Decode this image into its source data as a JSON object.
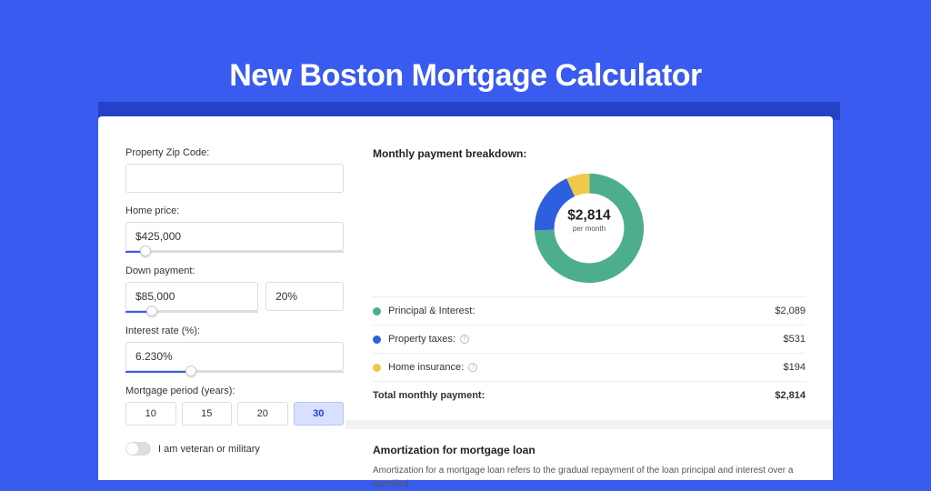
{
  "page_title": "New Boston Mortgage Calculator",
  "form": {
    "zip_label": "Property Zip Code:",
    "zip_value": "",
    "home_price_label": "Home price:",
    "home_price_value": "$425,000",
    "home_price_slider_pct": 9,
    "down_payment_label": "Down payment:",
    "down_payment_value": "$85,000",
    "down_payment_pct_value": "20%",
    "down_payment_slider_pct": 20,
    "interest_label": "Interest rate (%):",
    "interest_value": "6.230%",
    "interest_slider_pct": 30,
    "period_label": "Mortgage period (years):",
    "periods": [
      "10",
      "15",
      "20",
      "30"
    ],
    "period_selected": "30",
    "veteran_label": "I am veteran or military"
  },
  "breakdown": {
    "title": "Monthly payment breakdown:",
    "center_amount": "$2,814",
    "center_sub": "per month",
    "items": [
      {
        "label": "Principal & Interest:",
        "value": "$2,089",
        "value_num": 2089,
        "color": "#4cae8f",
        "has_info": false
      },
      {
        "label": "Property taxes:",
        "value": "$531",
        "value_num": 531,
        "color": "#2d5fde",
        "has_info": true
      },
      {
        "label": "Home insurance:",
        "value": "$194",
        "value_num": 194,
        "color": "#f2c84b",
        "has_info": true
      }
    ],
    "total_label": "Total monthly payment:",
    "total_value": "$2,814"
  },
  "amortization": {
    "title": "Amortization for mortgage loan",
    "text": "Amortization for a mortgage loan refers to the gradual repayment of the loan principal and interest over a specified"
  },
  "chart_data": {
    "type": "pie",
    "title": "Monthly payment breakdown",
    "series": [
      {
        "name": "Principal & Interest",
        "value": 2089,
        "color": "#4cae8f"
      },
      {
        "name": "Property taxes",
        "value": 531,
        "color": "#2d5fde"
      },
      {
        "name": "Home insurance",
        "value": 194,
        "color": "#f2c84b"
      }
    ],
    "total": 2814,
    "center_label": "$2,814 per month"
  }
}
